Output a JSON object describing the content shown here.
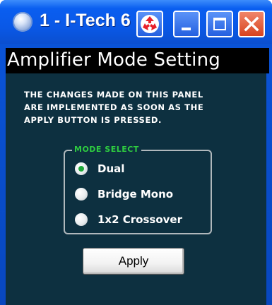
{
  "window": {
    "title": "1 - I-Tech 6",
    "icons": {
      "app": "app-globe-icon",
      "recycle": "recycle-icon",
      "minimize": "minimize-icon",
      "maximize": "maximize-icon",
      "close": "close-icon"
    }
  },
  "panel": {
    "header": "Amplifier Mode Setting",
    "notice_lines": [
      "THE CHANGES MADE ON THIS PANEL",
      "ARE IMPLEMENTED AS SOON AS THE",
      "APPLY BUTTON IS PRESSED."
    ],
    "mode_select": {
      "legend": "MODE SELECT",
      "options": [
        {
          "label": "Dual",
          "selected": true
        },
        {
          "label": "Bridge Mono",
          "selected": false
        },
        {
          "label": "1x2 Crossover",
          "selected": false
        }
      ]
    },
    "apply_label": "Apply"
  },
  "colors": {
    "panel_background": "#0d3040",
    "legend_accent": "#2ecc40",
    "titlebar_blue": "#0a58e6",
    "close_red": "#d8431f"
  }
}
